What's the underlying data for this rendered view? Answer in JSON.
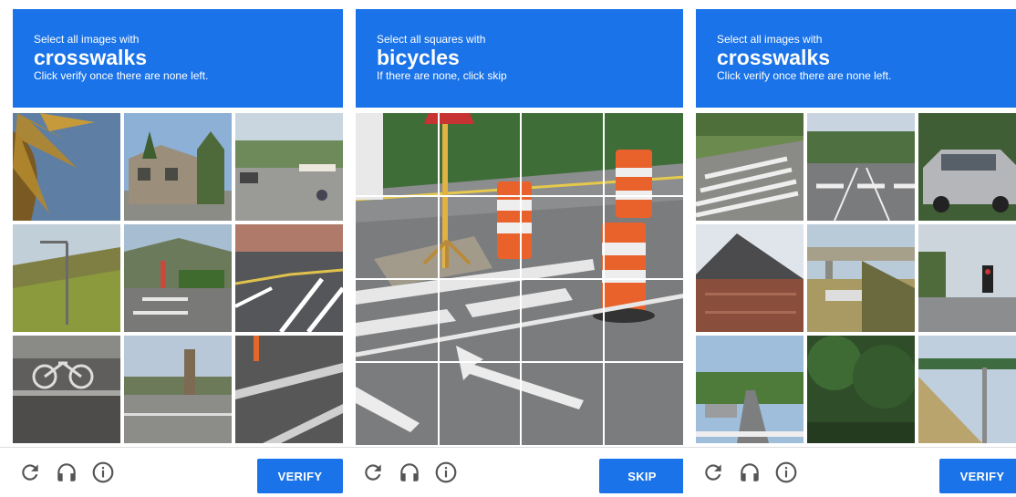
{
  "panels": [
    {
      "instruction": "Select all images with",
      "keyword": "crosswalks",
      "subtext": "Click verify once there are none left.",
      "button_label": "VERIFY"
    },
    {
      "instruction": "Select all squares with",
      "keyword": "bicycles",
      "subtext": "If there are none, click skip",
      "button_label": "SKIP"
    },
    {
      "instruction": "Select all images with",
      "keyword": "crosswalks",
      "subtext": "Click verify once there are none left.",
      "button_label": "VERIFY"
    }
  ],
  "icons": {
    "reload": "reload-icon",
    "audio": "headphones-icon",
    "info": "info-icon"
  },
  "colors": {
    "header_bg": "#1a73e8",
    "button_bg": "#1a73e8",
    "icon_color": "#555555"
  }
}
